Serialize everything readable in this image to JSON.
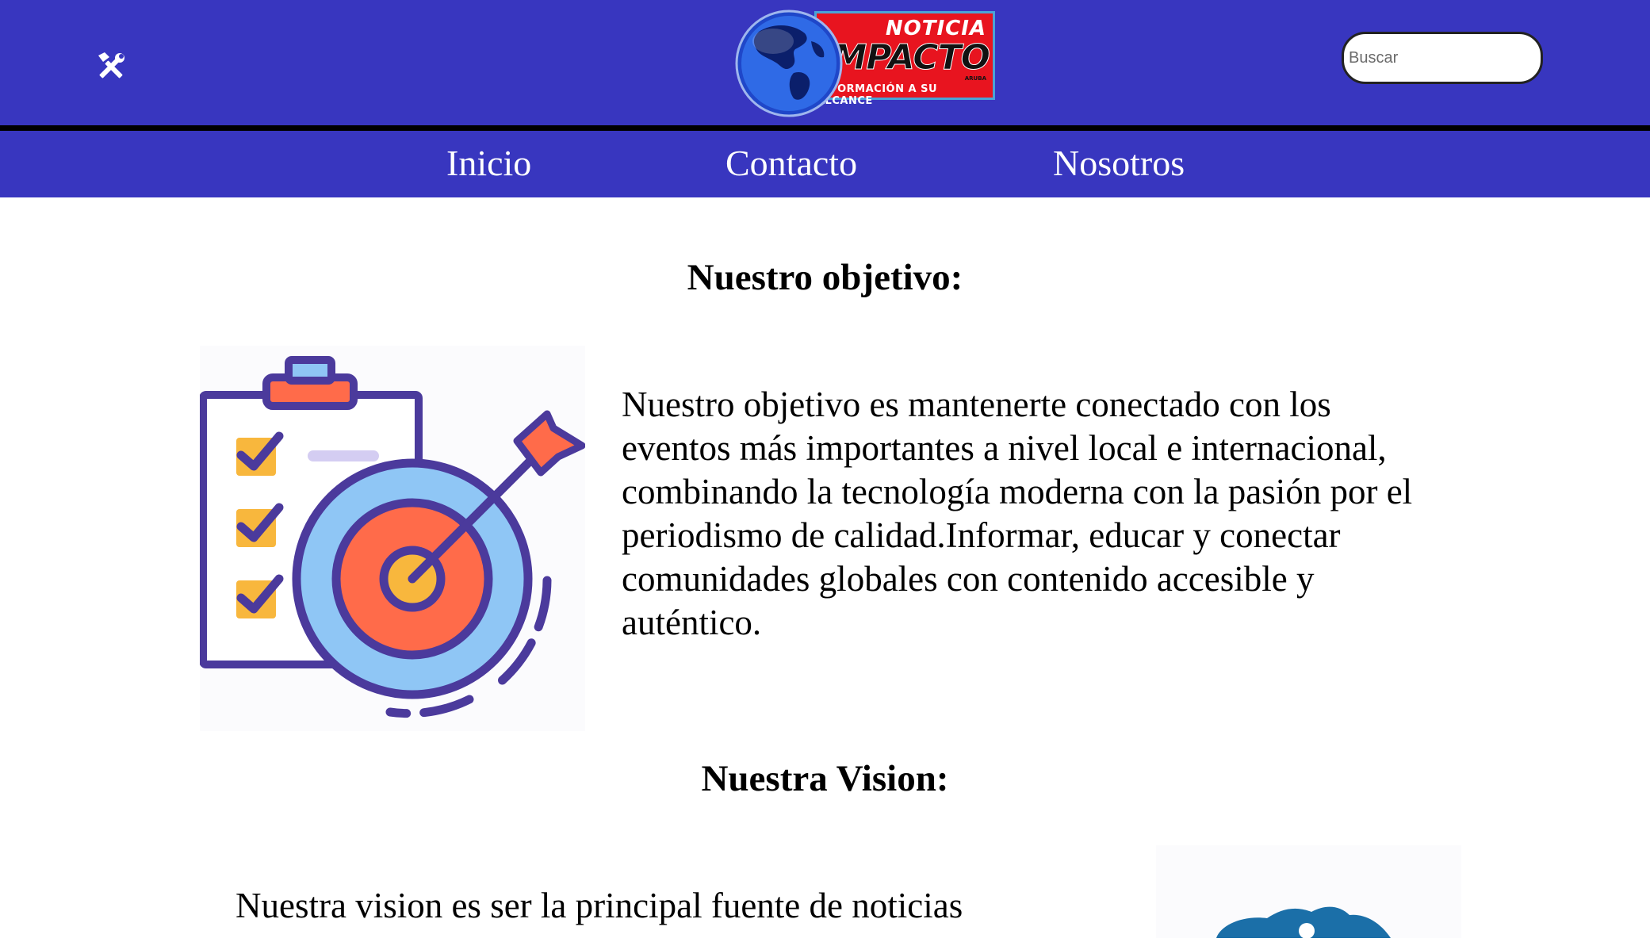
{
  "header": {
    "logo": {
      "line1": "NOTICIA",
      "line2": "IMPACTO",
      "tag": "ARUBA",
      "slogan": "INFORMACIÓN A SU ALCANCE"
    },
    "search": {
      "placeholder": "Buscar",
      "value": ""
    },
    "tools_icon": "tools-icon"
  },
  "nav": {
    "items": [
      {
        "label": "Inicio"
      },
      {
        "label": "Contacto"
      },
      {
        "label": "Nosotros"
      }
    ]
  },
  "sections": {
    "objetivo": {
      "title": "Nuestro objetivo:",
      "body": "Nuestro objetivo es mantenerte conectado con los eventos más importantes a nivel local e internacional, combinando la tecnología moderna con la pasión por el periodismo de calidad.Informar, educar y conectar comunidades globales con contenido accesible y auténtico.",
      "image": "target-checklist-illustration"
    },
    "vision": {
      "title": "Nuestra Vision:",
      "body": "Nuestra vision es ser la principal fuente de noticias",
      "image": "vision-illustration"
    }
  },
  "colors": {
    "header_bg": "#3836bf",
    "divider": "#000000",
    "logo_red": "#e8141f"
  }
}
